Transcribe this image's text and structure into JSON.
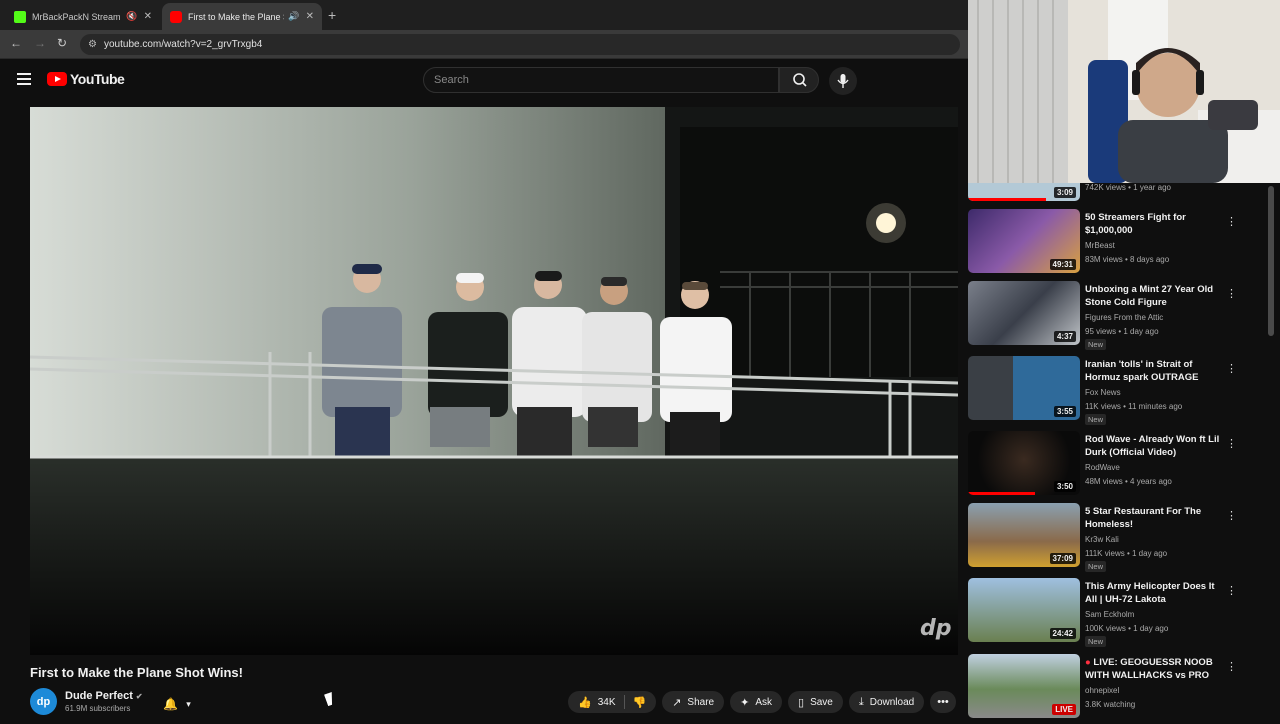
{
  "browser": {
    "tabs": [
      {
        "title": "MrBackPackN Stream - Wa",
        "favicon_color": "#53fc18"
      },
      {
        "title": "First to Make the Plane Shot",
        "favicon_color": "#ff0000"
      }
    ],
    "url": "youtube.com/watch?v=2_grvTrxgb4"
  },
  "youtube": {
    "logo": "YouTube",
    "search_placeholder": "Search"
  },
  "video": {
    "title": "First to Make the Plane Shot Wins!",
    "watermark": "dp",
    "channel": {
      "name": "Dude Perfect",
      "subscribers": "61.9M subscribers",
      "avatar_text": "dp"
    },
    "actions": {
      "likes": "34K",
      "share": "Share",
      "ask": "Ask",
      "save": "Save",
      "download": "Download"
    }
  },
  "recommendations": [
    {
      "title": "",
      "meta1": "742K views • 1 year ago",
      "duration": "3:09",
      "color": "#b3c9d6"
    },
    {
      "title": "50 Streamers Fight for $1,000,000",
      "channel": "MrBeast",
      "meta": "83M views • 8 days ago",
      "duration": "49:31",
      "color": "#6a4a8a"
    },
    {
      "title": "Unboxing a Mint 27 Year Old Stone Cold Figure",
      "channel": "Figures From the Attic",
      "meta": "95 views • 1 day ago",
      "badge": "New",
      "duration": "4:37",
      "color": "#5a5f6a"
    },
    {
      "title": "Iranian 'tolls' in Strait of Hormuz spark OUTRAGE",
      "channel": "Fox News",
      "meta": "11K views • 11 minutes ago",
      "badge": "New",
      "duration": "3:55",
      "color": "#2f5f8a"
    },
    {
      "title": "Rod Wave - Already Won ft Lil Durk (Official Video)",
      "channel": "RodWave",
      "meta": "48M views • 4 years ago",
      "duration": "3:50",
      "color": "#1a1a1a"
    },
    {
      "title": "5 Star Restaurant For The Homeless!",
      "channel": "Kr3w Kali",
      "meta": "111K views • 1 day ago",
      "badge": "New",
      "duration": "37:09",
      "color": "#8a6a4a"
    },
    {
      "title": "This Army Helicopter Does It All | UH-72 Lakota",
      "channel": "Sam Eckholm",
      "meta": "100K views • 1 day ago",
      "badge": "New",
      "duration": "24:42",
      "color": "#7fa3c9"
    },
    {
      "title": "LIVE: GEOGUESSR NOOB WITH WALLHACKS vs PRO",
      "channel": "ohnepixel",
      "meta": "3.8K watching",
      "duration": "LIVE",
      "color": "#6a8a5a"
    }
  ]
}
